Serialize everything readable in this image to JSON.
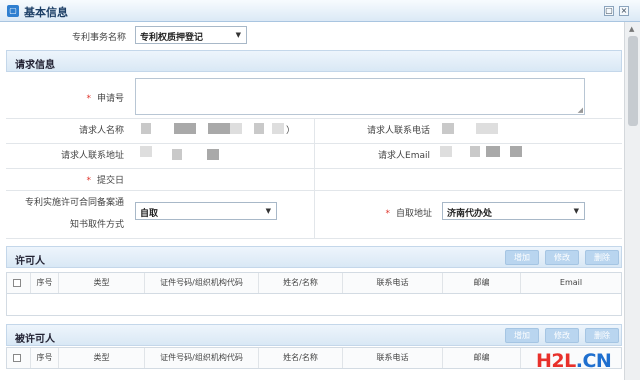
{
  "window": {
    "title": "基本信息",
    "btn_restore": "▢",
    "btn_close": "×"
  },
  "form": {
    "matter_label": "专利事务名称",
    "matter_value": "专利权质押登记",
    "caret": "▼"
  },
  "request_section": {
    "title": "请求信息",
    "app_no_label": "申请号",
    "requester_name_label": "请求人名称",
    "requester_phone_label": "请求人联系电话",
    "requester_addr_label": "请求人联系地址",
    "requester_email_label": "请求人Email",
    "submit_date_label": "提交日",
    "notice_method_label_line1": "专利实施许可合同备案通",
    "notice_method_label_line2": "知书取件方式",
    "notice_method_value": "自取",
    "pickup_label": "自取地址",
    "pickup_value": "济南代办处",
    "name_suffix": "）",
    "required_mark": "*"
  },
  "licensor_section": {
    "title": "许可人",
    "buttons": {
      "add": "增加",
      "edit": "修改",
      "delete": "删除"
    },
    "columns": [
      "序号",
      "类型",
      "证件号码/组织机构代码",
      "姓名/名称",
      "联系电话",
      "邮编",
      "Email"
    ]
  },
  "licensee_section": {
    "title": "被许可人",
    "buttons": {
      "add": "增加",
      "edit": "修改",
      "delete": "删除"
    },
    "columns": [
      "序号",
      "类型",
      "证件号码/组织机构代码",
      "姓名/名称",
      "联系电话",
      "邮编"
    ]
  },
  "watermark": {
    "part1": "H2L",
    "part2": ".CN"
  }
}
